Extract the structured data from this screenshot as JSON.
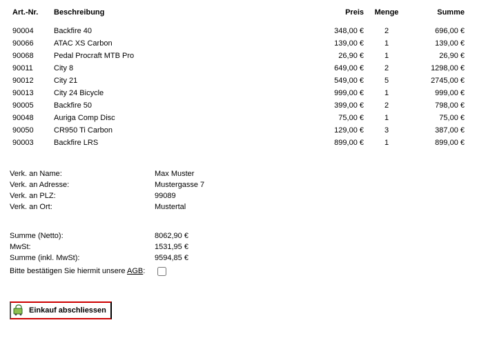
{
  "headers": {
    "art": "Art.-Nr.",
    "desc": "Beschreibung",
    "preis": "Preis",
    "menge": "Menge",
    "summe": "Summe"
  },
  "items": [
    {
      "art": "90004",
      "desc": "Backfire 40",
      "preis": "348,00 €",
      "menge": "2",
      "summe": "696,00 €"
    },
    {
      "art": "90066",
      "desc": "ATAC XS Carbon",
      "preis": "139,00 €",
      "menge": "1",
      "summe": "139,00 €"
    },
    {
      "art": "90068",
      "desc": "Pedal Procraft MTB Pro",
      "preis": "26,90 €",
      "menge": "1",
      "summe": "26,90 €"
    },
    {
      "art": "90011",
      "desc": "City 8",
      "preis": "649,00 €",
      "menge": "2",
      "summe": "1298,00 €"
    },
    {
      "art": "90012",
      "desc": "City 21",
      "preis": "549,00 €",
      "menge": "5",
      "summe": "2745,00 €"
    },
    {
      "art": "90013",
      "desc": "City 24 Bicycle",
      "preis": "999,00 €",
      "menge": "1",
      "summe": "999,00 €"
    },
    {
      "art": "90005",
      "desc": "Backfire 50",
      "preis": "399,00 €",
      "menge": "2",
      "summe": "798,00 €"
    },
    {
      "art": "90048",
      "desc": "Auriga Comp Disc",
      "preis": "75,00 €",
      "menge": "1",
      "summe": "75,00 €"
    },
    {
      "art": "90050",
      "desc": "CR950 Ti Carbon",
      "preis": "129,00 €",
      "menge": "3",
      "summe": "387,00 €"
    },
    {
      "art": "90003",
      "desc": "Backfire LRS",
      "preis": "899,00 €",
      "menge": "1",
      "summe": "899,00 €"
    }
  ],
  "ship": {
    "name_label": "Verk. an Name:",
    "name_value": "Max Muster",
    "addr_label": "Verk. an Adresse:",
    "addr_value": "Mustergasse 7",
    "plz_label": "Verk. an PLZ:",
    "plz_value": "99089",
    "ort_label": "Verk. an Ort:",
    "ort_value": "Mustertal"
  },
  "totals": {
    "netto_label": "Summe (Netto):",
    "netto_value": "8062,90 €",
    "mwst_label": "MwSt:",
    "mwst_value": "1531,95 €",
    "gross_label": "Summe (inkl. MwSt):",
    "gross_value": "9594,85 €"
  },
  "agb": {
    "text_pre": "Bitte bestätigen Sie hiermit unsere ",
    "link": "AGB",
    "text_post": ":"
  },
  "checkout_label": "Einkauf abschliessen"
}
